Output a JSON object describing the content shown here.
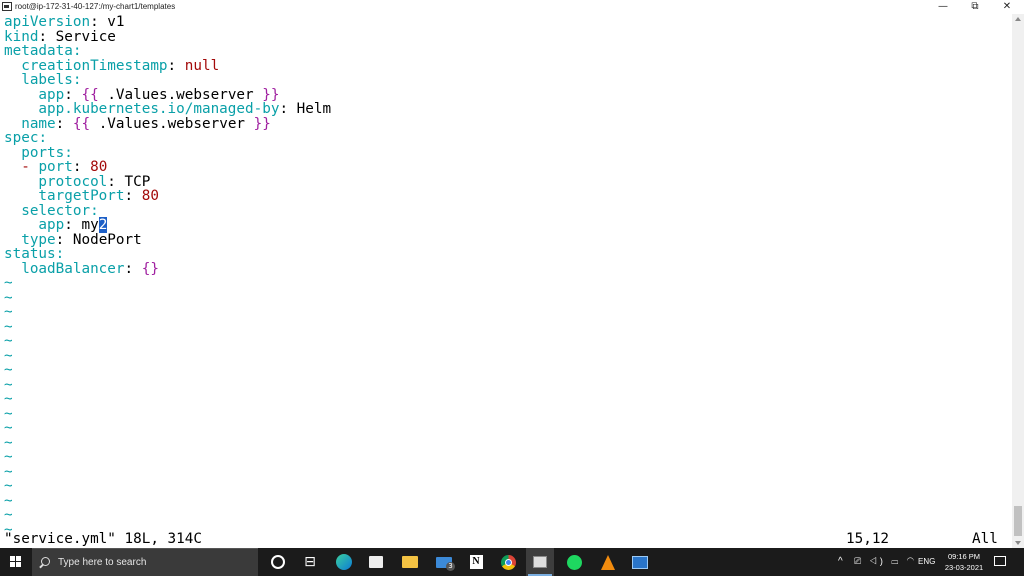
{
  "window": {
    "title": "root@ip-172-31-40-127:/my-chart1/templates",
    "minimize": "—",
    "maximize": "⧉",
    "close": "✕"
  },
  "editor": {
    "lines": [
      [
        {
          "t": "apiVersion",
          "c": "k"
        },
        {
          "t": ": ",
          "c": "b"
        },
        {
          "t": "v1",
          "c": "b"
        }
      ],
      [
        {
          "t": "kind",
          "c": "k"
        },
        {
          "t": ": ",
          "c": "b"
        },
        {
          "t": "Service",
          "c": "b"
        }
      ],
      [
        {
          "t": "metadata",
          "c": "k"
        },
        {
          "t": ":",
          "c": "k"
        }
      ],
      [
        {
          "t": "  creationTimestamp",
          "c": "k"
        },
        {
          "t": ": ",
          "c": "b"
        },
        {
          "t": "null",
          "c": "r"
        }
      ],
      [
        {
          "t": "  labels",
          "c": "k"
        },
        {
          "t": ":",
          "c": "k"
        }
      ],
      [
        {
          "t": "    app",
          "c": "k"
        },
        {
          "t": ": ",
          "c": "b"
        },
        {
          "t": "{{ ",
          "c": "m"
        },
        {
          "t": ".Values.webserver",
          "c": "b"
        },
        {
          "t": " }}",
          "c": "m"
        }
      ],
      [
        {
          "t": "    app.kubernetes.io/managed-by",
          "c": "k"
        },
        {
          "t": ": ",
          "c": "b"
        },
        {
          "t": "Helm",
          "c": "b"
        }
      ],
      [
        {
          "t": "  name",
          "c": "k"
        },
        {
          "t": ": ",
          "c": "b"
        },
        {
          "t": "{{ ",
          "c": "m"
        },
        {
          "t": ".Values.webserver",
          "c": "b"
        },
        {
          "t": " }}",
          "c": "m"
        }
      ],
      [
        {
          "t": "spec",
          "c": "k"
        },
        {
          "t": ":",
          "c": "k"
        }
      ],
      [
        {
          "t": "  ports",
          "c": "k"
        },
        {
          "t": ":",
          "c": "k"
        }
      ],
      [
        {
          "t": "  - ",
          "c": "r"
        },
        {
          "t": "port",
          "c": "k"
        },
        {
          "t": ": ",
          "c": "b"
        },
        {
          "t": "80",
          "c": "r"
        }
      ],
      [
        {
          "t": "    protocol",
          "c": "k"
        },
        {
          "t": ": ",
          "c": "b"
        },
        {
          "t": "TCP",
          "c": "b"
        }
      ],
      [
        {
          "t": "    targetPort",
          "c": "k"
        },
        {
          "t": ": ",
          "c": "b"
        },
        {
          "t": "80",
          "c": "r"
        }
      ],
      [
        {
          "t": "  selector",
          "c": "k"
        },
        {
          "t": ":",
          "c": "k"
        }
      ],
      [
        {
          "t": "    app",
          "c": "k"
        },
        {
          "t": ": ",
          "c": "b"
        },
        {
          "t": "my",
          "c": "b"
        },
        {
          "t": "2",
          "c": "cursor"
        }
      ],
      [
        {
          "t": "  type",
          "c": "k"
        },
        {
          "t": ": ",
          "c": "b"
        },
        {
          "t": "NodePort",
          "c": "b"
        }
      ],
      [
        {
          "t": "status",
          "c": "k"
        },
        {
          "t": ":",
          "c": "k"
        }
      ],
      [
        {
          "t": "  loadBalancer",
          "c": "k"
        },
        {
          "t": ": ",
          "c": "b"
        },
        {
          "t": "{}",
          "c": "m"
        }
      ]
    ],
    "tilde": "~",
    "tilde_count": 18,
    "status_file": "\"service.yml\" 18L, 314C",
    "status_position": "15,12",
    "status_scroll": "All"
  },
  "taskbar": {
    "search_placeholder": "Type here to search",
    "mail_badge": "3",
    "notion_letter": "N",
    "tray_chevron": "^",
    "tray_icons": "⎚ ◁) ▭ ◠",
    "language": "ENG",
    "time": "09:16 PM",
    "date": "23-03-2021"
  },
  "colors": {
    "keyword": "#0aa0a8",
    "template": "#a020a0",
    "literal": "#a30a0a",
    "cursor": "#1c5fc7",
    "taskbar": "#1b1b1b"
  }
}
